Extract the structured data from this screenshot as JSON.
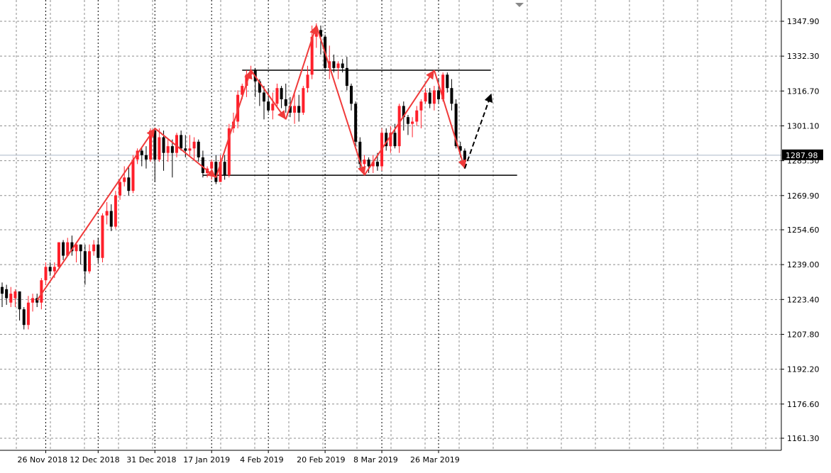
{
  "chart_data": {
    "type": "candlestick",
    "title": "",
    "grid": true,
    "colors": {
      "bull": "#ff1f2a",
      "bear": "#000000",
      "pattern": "#f03a3a",
      "level": "#000000",
      "price_line": "#aab7c8",
      "grid": "#8e8e8e",
      "price_label_bg": "#000000",
      "price_label_text": "#ffffff"
    },
    "y_axis": {
      "range": [
        1152.2,
        1356.0
      ],
      "ticks": [
        "1347.90",
        "1332.30",
        "1316.70",
        "1301.10",
        "1285.50",
        "1269.90",
        "1254.60",
        "1239.00",
        "1223.40",
        "1207.80",
        "1192.20",
        "1176.60",
        "1161.30"
      ],
      "current_price": "1287.98"
    },
    "x_axis": {
      "ticks": [
        "26 Nov 2018",
        "12 Dec 2018",
        "31 Dec 2018",
        "17 Jan 2019",
        "4 Feb 2019",
        "20 Feb 2019",
        "8 Mar 2019",
        "26 Mar 2019"
      ],
      "tick_bar_index": [
        10,
        22,
        35,
        48,
        61,
        74,
        87,
        100
      ]
    },
    "candles": [
      [
        1229,
        1226,
        1231,
        1220
      ],
      [
        1228,
        1224,
        1230,
        1221
      ],
      [
        1222,
        1226,
        1229,
        1220
      ],
      [
        1224,
        1227,
        1228,
        1220
      ],
      [
        1227,
        1219,
        1227,
        1214
      ],
      [
        1219,
        1212,
        1220,
        1210
      ],
      [
        1212,
        1222,
        1225,
        1210
      ],
      [
        1222,
        1224,
        1226,
        1218
      ],
      [
        1224,
        1222,
        1226,
        1220
      ],
      [
        1222,
        1232,
        1233,
        1219
      ],
      [
        1232,
        1238,
        1240,
        1230
      ],
      [
        1238,
        1236,
        1240,
        1234
      ],
      [
        1236,
        1238,
        1240,
        1233
      ],
      [
        1238,
        1249,
        1249,
        1237
      ],
      [
        1249,
        1243,
        1250,
        1241
      ],
      [
        1243,
        1249,
        1251,
        1243
      ],
      [
        1249,
        1245,
        1252,
        1243
      ],
      [
        1245,
        1248,
        1249,
        1240
      ],
      [
        1248,
        1245,
        1248,
        1239
      ],
      [
        1245,
        1236,
        1248,
        1230
      ],
      [
        1236,
        1245,
        1248,
        1235
      ],
      [
        1245,
        1248,
        1250,
        1243
      ],
      [
        1248,
        1242,
        1251,
        1240
      ],
      [
        1242,
        1261,
        1262,
        1240
      ],
      [
        1261,
        1263,
        1267,
        1257
      ],
      [
        1263,
        1256,
        1266,
        1254
      ],
      [
        1256,
        1270,
        1272,
        1255
      ],
      [
        1270,
        1276,
        1277,
        1268
      ],
      [
        1276,
        1278,
        1283,
        1274
      ],
      [
        1278,
        1272,
        1283,
        1270
      ],
      [
        1272,
        1286,
        1288,
        1271
      ],
      [
        1286,
        1290,
        1291,
        1284
      ],
      [
        1290,
        1288,
        1291,
        1283
      ],
      [
        1288,
        1286,
        1292,
        1282
      ],
      [
        1286,
        1299,
        1300,
        1285
      ],
      [
        1299,
        1286,
        1300,
        1276
      ],
      [
        1286,
        1296,
        1300,
        1285
      ],
      [
        1296,
        1289,
        1299,
        1281
      ],
      [
        1289,
        1292,
        1295,
        1285
      ],
      [
        1292,
        1289,
        1295,
        1278
      ],
      [
        1289,
        1297,
        1298,
        1287
      ],
      [
        1297,
        1291,
        1299,
        1290
      ],
      [
        1291,
        1290,
        1297,
        1287
      ],
      [
        1290,
        1291,
        1297,
        1288
      ],
      [
        1291,
        1294,
        1296,
        1286
      ],
      [
        1294,
        1287,
        1295,
        1285
      ],
      [
        1287,
        1280,
        1290,
        1278
      ],
      [
        1280,
        1282,
        1283,
        1278
      ],
      [
        1282,
        1285,
        1286,
        1277
      ],
      [
        1285,
        1276,
        1288,
        1275
      ],
      [
        1276,
        1285,
        1288,
        1276
      ],
      [
        1285,
        1279,
        1288,
        1277
      ],
      [
        1279,
        1300,
        1302,
        1278
      ],
      [
        1300,
        1303,
        1307,
        1298
      ],
      [
        1303,
        1315,
        1317,
        1300
      ],
      [
        1315,
        1319,
        1320,
        1313
      ],
      [
        1319,
        1324,
        1326,
        1314
      ],
      [
        1324,
        1326,
        1328,
        1323
      ],
      [
        1326,
        1321,
        1327,
        1314
      ],
      [
        1321,
        1316,
        1322,
        1310
      ],
      [
        1316,
        1312,
        1319,
        1304
      ],
      [
        1312,
        1308,
        1318,
        1307
      ],
      [
        1308,
        1311,
        1316,
        1304
      ],
      [
        1311,
        1318,
        1320,
        1309
      ],
      [
        1318,
        1313,
        1319,
        1309
      ],
      [
        1313,
        1310,
        1320,
        1307
      ],
      [
        1310,
        1307,
        1314,
        1305
      ],
      [
        1307,
        1310,
        1316,
        1302
      ],
      [
        1310,
        1307,
        1315,
        1303
      ],
      [
        1307,
        1318,
        1319,
        1306
      ],
      [
        1318,
        1324,
        1328,
        1316
      ],
      [
        1324,
        1341,
        1346,
        1322
      ],
      [
        1341,
        1344,
        1347,
        1336
      ],
      [
        1344,
        1341,
        1346,
        1333
      ],
      [
        1341,
        1327,
        1342,
        1326
      ],
      [
        1327,
        1330,
        1337,
        1322
      ],
      [
        1330,
        1327,
        1333,
        1325
      ],
      [
        1327,
        1329,
        1330,
        1322
      ],
      [
        1329,
        1327,
        1331,
        1325
      ],
      [
        1327,
        1319,
        1332,
        1317
      ],
      [
        1319,
        1311,
        1320,
        1308
      ],
      [
        1311,
        1294,
        1312,
        1292
      ],
      [
        1294,
        1284,
        1296,
        1282
      ],
      [
        1284,
        1286,
        1288,
        1279
      ],
      [
        1286,
        1283,
        1287,
        1280
      ],
      [
        1283,
        1285,
        1288,
        1280
      ],
      [
        1285,
        1283,
        1289,
        1281
      ],
      [
        1283,
        1298,
        1300,
        1281
      ],
      [
        1298,
        1292,
        1300,
        1290
      ],
      [
        1292,
        1298,
        1301,
        1289
      ],
      [
        1298,
        1292,
        1302,
        1291
      ],
      [
        1292,
        1310,
        1311,
        1289
      ],
      [
        1310,
        1305,
        1312,
        1299
      ],
      [
        1305,
        1302,
        1306,
        1297
      ],
      [
        1302,
        1303,
        1305,
        1296
      ],
      [
        1303,
        1308,
        1310,
        1301
      ],
      [
        1308,
        1312,
        1313,
        1300
      ],
      [
        1312,
        1316,
        1318,
        1311
      ],
      [
        1316,
        1311,
        1318,
        1309
      ],
      [
        1311,
        1317,
        1319,
        1308
      ],
      [
        1317,
        1313,
        1322,
        1311
      ],
      [
        1313,
        1324,
        1325,
        1312
      ],
      [
        1324,
        1318,
        1325,
        1316
      ],
      [
        1318,
        1311,
        1322,
        1308
      ],
      [
        1311,
        1292,
        1313,
        1291
      ],
      [
        1292,
        1290,
        1294,
        1287
      ],
      [
        1290,
        1285,
        1291,
        1283
      ]
    ],
    "pattern_lines": [
      {
        "name": "rally",
        "points": [
          [
            8,
            1223
          ],
          [
            35,
            1300
          ]
        ],
        "arrow": true
      },
      {
        "name": "pullback",
        "points": [
          [
            35,
            1300
          ],
          [
            49,
            1278
          ]
        ],
        "arrow": true
      },
      {
        "name": "left-shoulder-up",
        "points": [
          [
            49,
            1278
          ],
          [
            57,
            1326
          ]
        ],
        "arrow": true
      },
      {
        "name": "left-shoulder-down",
        "points": [
          [
            57,
            1326
          ],
          [
            65,
            1304
          ]
        ],
        "arrow": true
      },
      {
        "name": "head-up",
        "points": [
          [
            65,
            1304
          ],
          [
            72,
            1346
          ]
        ],
        "arrow": true
      },
      {
        "name": "head-down",
        "points": [
          [
            72,
            1346
          ],
          [
            83,
            1279
          ]
        ],
        "arrow": true
      },
      {
        "name": "right-shoulder-up",
        "points": [
          [
            83,
            1279
          ],
          [
            99,
            1326
          ]
        ],
        "arrow": true
      },
      {
        "name": "right-shoulder-down",
        "points": [
          [
            99,
            1326
          ],
          [
            106,
            1282
          ]
        ],
        "arrow": true
      }
    ],
    "projection": {
      "points": [
        [
          106,
          1282
        ],
        [
          112,
          1315
        ]
      ]
    },
    "levels": [
      {
        "name": "resistance",
        "price": 1326,
        "from_bar": 55,
        "to_bar": 112
      },
      {
        "name": "support",
        "price": 1279,
        "from_bar": 46,
        "to_bar": 118
      }
    ]
  }
}
